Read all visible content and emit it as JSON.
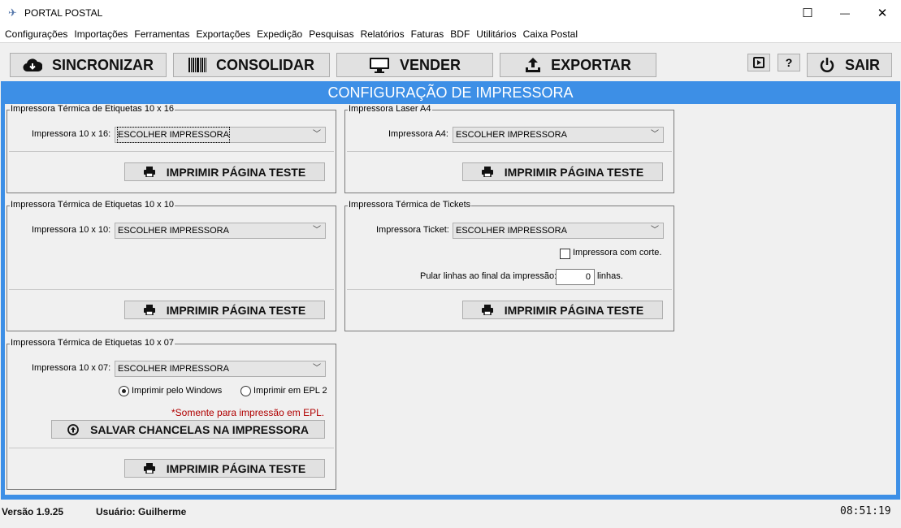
{
  "window": {
    "title": "PORTAL POSTAL",
    "minimize_glyph": "—",
    "maximize_glyph": "☐",
    "close_glyph": "✕"
  },
  "menu": [
    "Configurações",
    "Importações",
    "Ferramentas",
    "Exportações",
    "Expedição",
    "Pesquisas",
    "Relatórios",
    "Faturas",
    "BDF",
    "Utilitários",
    "Caixa Postal"
  ],
  "toolbar": {
    "sincronizar": "SINCRONIZAR",
    "consolidar": "CONSOLIDAR",
    "vender": "VENDER",
    "exportar": "EXPORTAR",
    "help": "?",
    "sair": "SAIR"
  },
  "page_title": "CONFIGURAÇÃO DE IMPRESSORA",
  "groups": {
    "g10x16": {
      "title": "Impressora Térmica de Etiquetas 10 x 16",
      "label": "Impressora 10 x 16:",
      "value": "ESCOLHER IMPRESSORA",
      "test_button": "IMPRIMIR PÁGINA TESTE"
    },
    "a4": {
      "title": "Impressora Laser A4",
      "label": "Impressora A4:",
      "value": "ESCOLHER IMPRESSORA",
      "test_button": "IMPRIMIR PÁGINA TESTE"
    },
    "g10x10": {
      "title": "Impressora Térmica de Etiquetas 10 x 10",
      "label": "Impressora 10 x 10:",
      "value": "ESCOLHER IMPRESSORA",
      "test_button": "IMPRIMIR PÁGINA TESTE"
    },
    "tickets": {
      "title": "Impressora Térmica de Tickets",
      "label": "Impressora Ticket:",
      "value": "ESCOLHER IMPRESSORA",
      "cut_label": "Impressora com corte.",
      "cut_checked": false,
      "skip_label": "Pular linhas ao final da impressão:",
      "skip_value": "0",
      "skip_unit": "linhas.",
      "test_button": "IMPRIMIR PÁGINA TESTE"
    },
    "g10x07": {
      "title": "Impressora Térmica de Etiquetas 10 x 07",
      "label": "Impressora 10 x 07:",
      "value": "ESCOLHER IMPRESSORA",
      "radio_windows": "Imprimir pelo Windows",
      "radio_epl": "Imprimir em EPL 2",
      "selected_radio": "windows",
      "note": "*Somente para impressão em EPL.",
      "save_button": "SALVAR CHANCELAS NA IMPRESSORA",
      "test_button": "IMPRIMIR PÁGINA TESTE"
    }
  },
  "status": {
    "version": "Versão 1.9.25",
    "user": "Usuário: Guilherme",
    "clock": "08:51:19"
  },
  "colors": {
    "frame_blue": "#3d8fe6",
    "note_red": "#b00000"
  }
}
